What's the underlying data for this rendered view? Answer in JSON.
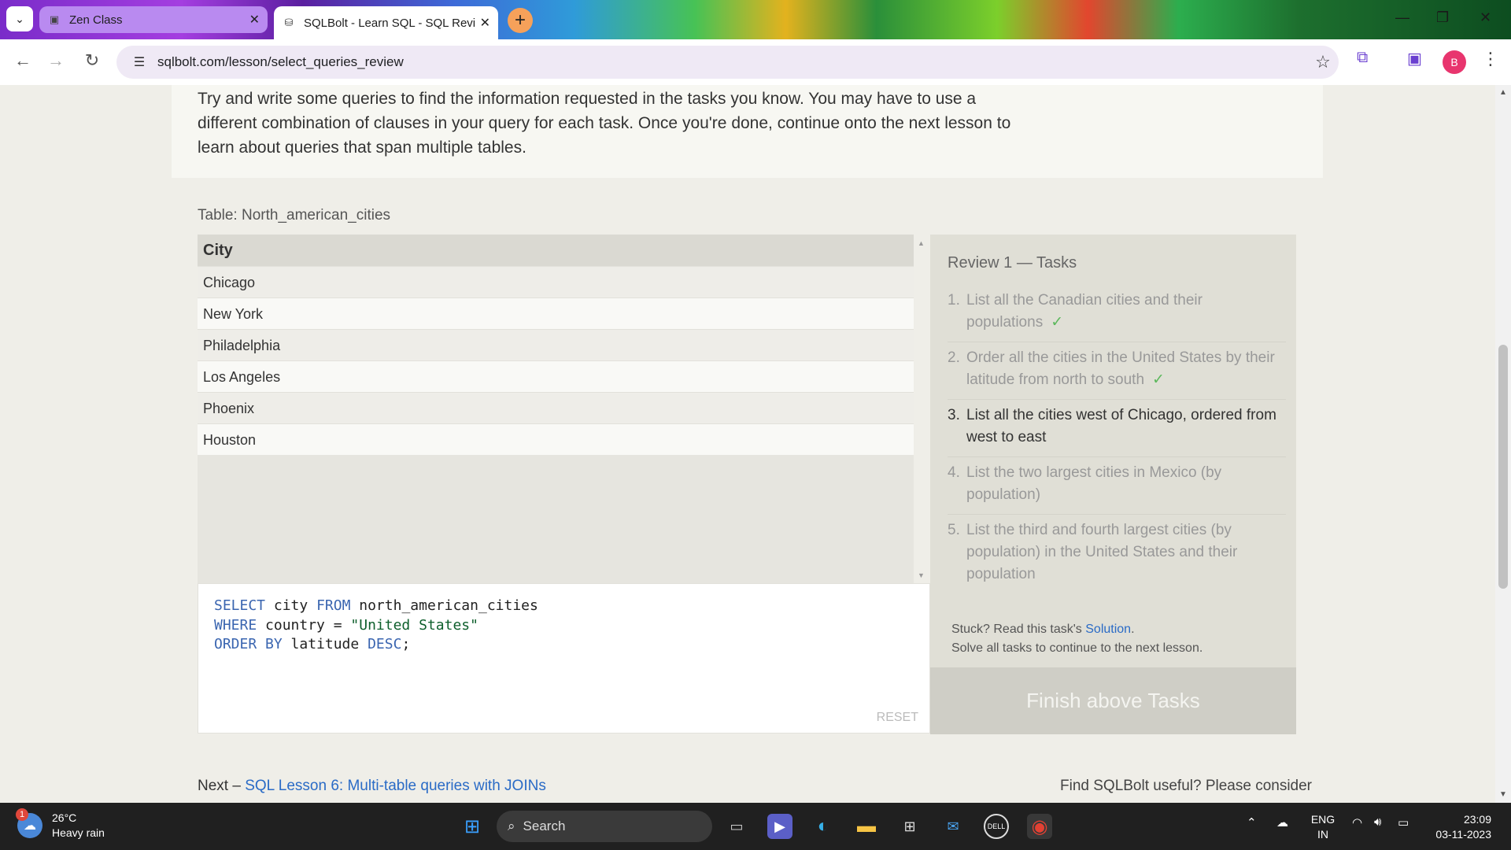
{
  "browser": {
    "tabs": [
      {
        "title": "Zen Class",
        "active": false
      },
      {
        "title": "SQLBolt - Learn SQL - SQL Review",
        "active": true
      }
    ],
    "url": "sqlbolt.com/lesson/select_queries_review",
    "profile_initial": "B"
  },
  "page": {
    "intro": "Try and write some queries to find the information requested in the tasks you know. You may have to use a different combination of clauses in your query for each task. Once you're done, continue onto the next lesson to learn about queries that span multiple tables.",
    "table_label": "Table: North_american_cities",
    "table": {
      "header": "City",
      "rows": [
        "Chicago",
        "New York",
        "Philadelphia",
        "Los Angeles",
        "Phoenix",
        "Houston"
      ]
    },
    "editor": {
      "line1_kw1": "SELECT",
      "line1_a": " city ",
      "line1_kw2": "FROM",
      "line1_b": " north_american_cities",
      "line2_kw1": "WHERE",
      "line2_a": " country = ",
      "line2_str": "\"United States\"",
      "line3_kw1": "ORDER BY",
      "line3_a": " latitude ",
      "line3_kw2": "DESC",
      "line3_b": ";",
      "reset_label": "RESET"
    },
    "tasks": {
      "title": "Review 1 — Tasks",
      "items": [
        {
          "num": "1.",
          "text": "List all the Canadian cities and their populations",
          "done": "✓"
        },
        {
          "num": "2.",
          "text": "Order all the cities in the United States by their latitude from north to south",
          "done": "✓"
        },
        {
          "num": "3.",
          "text": "List all the cities west of Chicago, ordered from west to east",
          "done": ""
        },
        {
          "num": "4.",
          "text": "List the two largest cities in Mexico (by population)",
          "done": ""
        },
        {
          "num": "5.",
          "text": "List the third and fourth largest cities (by population) in the United States and their population",
          "done": ""
        }
      ],
      "stuck_prefix": "Stuck? Read this task's ",
      "solution_link": "Solution",
      "stuck_suffix": ".",
      "solve_all": "Solve all tasks to continue to the next lesson.",
      "finish_label": "Finish above Tasks"
    },
    "next_prefix": "Next – ",
    "next_link": "SQL Lesson 6: Multi-table queries with JOINs",
    "useful": "Find SQLBolt useful? Please consider"
  },
  "taskbar": {
    "weather_badge": "1",
    "temp": "26°C",
    "condition": "Heavy rain",
    "search_label": "Search",
    "lang1": "ENG",
    "lang2": "IN",
    "time": "23:09",
    "date": "03-11-2023"
  }
}
